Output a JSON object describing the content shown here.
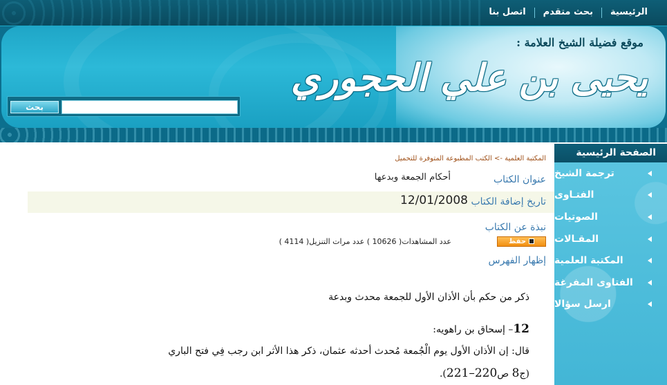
{
  "nav": {
    "home": "الرئيسية",
    "advanced_search": "بحث متقدم",
    "contact": "اتصل بنا"
  },
  "banner": {
    "subtitle": "موقع فضيلة الشيخ العلامة :",
    "title": "يحيى بن علي الحجوري",
    "search_placeholder": "",
    "search_button": "بحث"
  },
  "sidebar": {
    "header": "الصفحة الرئيسية",
    "items": [
      {
        "label": "ترجمة الشيخ"
      },
      {
        "label": "الفتـاوى"
      },
      {
        "label": "الصوتيات"
      },
      {
        "label": "المقـالات"
      },
      {
        "label": "المكتبة العلمية"
      },
      {
        "label": "الفتاوى المفرغة"
      },
      {
        "label": "ارسل سؤالا"
      }
    ]
  },
  "main": {
    "breadcrumb": "المكتبة العلمية -> الكتب المطبوعة المتوفرة للتحميل",
    "book_title_label": "عنوان الكتاب",
    "book_title": "أحكام الجمعة وبدعها",
    "date_label": "تاريخ إضافة الكتاب",
    "date": "12/01/2008",
    "about_label": "نبذة عن الكتاب",
    "save_button": "حفظ",
    "stats": "عدد المشاهدات( 10626 ) عدد مرات التنزيل( 4114 )",
    "show_index": "إظهار الفهرس"
  },
  "article": {
    "heading": "ذكر من حكم بأن الأذان الأول للجمعة محدث وبدعة",
    "item_number": "12",
    "item_author": "– إسحاق بن راهويه:",
    "body_line1": "قال: إن الأذان الأول يوم الْجُمعة مُحدث أحدثه عثمان، ذكر هذا الأثر ابن رجب فِي فتح الباري",
    "body_ref_part1": "(ج",
    "body_ref_vol": "8",
    "body_ref_part2": " ص",
    "body_ref_pages": "220–221",
    "body_ref_end": ")."
  }
}
